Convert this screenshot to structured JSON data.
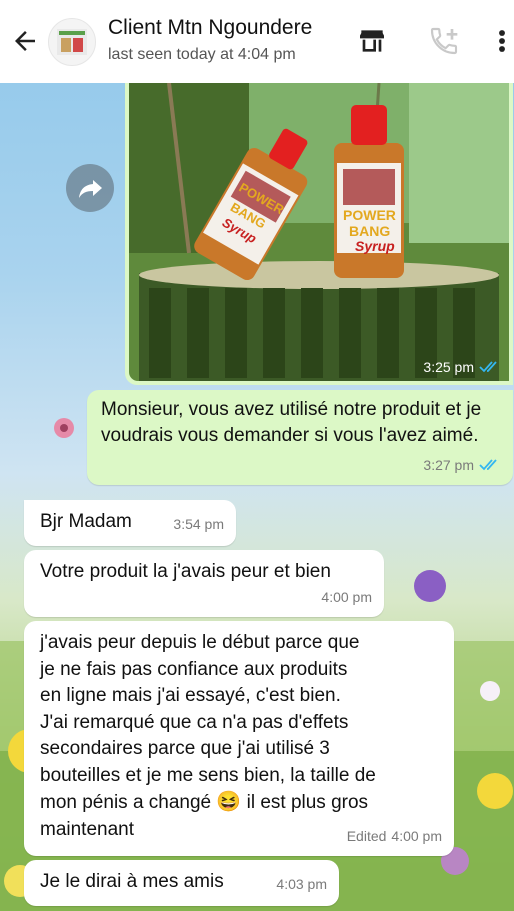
{
  "header": {
    "contact_name": "Client Mtn Ngoundere",
    "status": "last seen today at 4:04 pm",
    "icons": [
      "back-arrow-icon",
      "store-icon",
      "add-call-icon",
      "more-vert-icon"
    ]
  },
  "messages": [
    {
      "dir": "out",
      "type": "image",
      "time": "3:25 pm",
      "read": true,
      "labels": [
        "POWER",
        "BANG",
        "Syrup"
      ]
    },
    {
      "dir": "out",
      "text": "Monsieur, vous avez utilisé notre produit et je voudrais vous demander si vous l'avez aimé.",
      "time": "3:27 pm",
      "read": true
    },
    {
      "dir": "in",
      "text": "Bjr Madam",
      "time": "3:54 pm"
    },
    {
      "dir": "in",
      "text": "Votre produit la j'avais peur et bien",
      "time": "4:00 pm"
    },
    {
      "dir": "in",
      "text_lines": [
        "j'avais peur depuis le début parce que",
        "je ne fais pas confiance aux produits",
        "en ligne mais j'ai essayé, c'est bien.",
        "J'ai remarqué que ca n'a pas d'effets",
        "secondaires parce que j'ai utilisé 3",
        "bouteilles et je me sens bien, la taille de"
      ],
      "text_end": "mon pénis a changé",
      "emoji": "😆",
      "text_after": "il est plus gros",
      "text_last": "maintenant",
      "edited_label": "Edited",
      "time": "4:00 pm"
    },
    {
      "dir": "in",
      "text": "Je le dirai à mes amis",
      "time": "4:03 pm"
    }
  ],
  "colors": {
    "outgoing": "#dcf8c6",
    "incoming": "#ffffff",
    "read_ticks": "#34b7f1"
  }
}
